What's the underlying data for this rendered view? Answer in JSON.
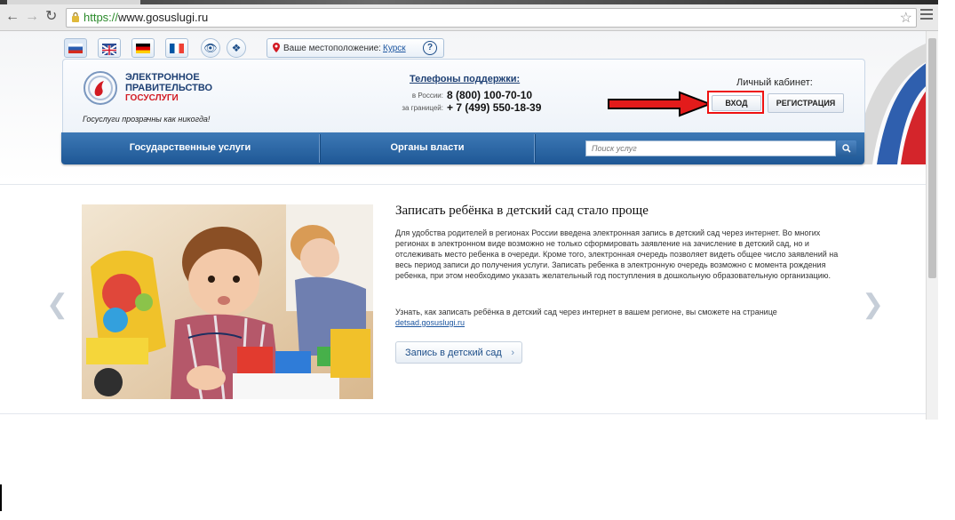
{
  "browser": {
    "url_prefix": "https://",
    "url_host": "www.gosuslugi.ru"
  },
  "colors": {
    "brand_blue": "#1d3f73",
    "nav_blue": "#2a63a3",
    "brand_red": "#d21a22",
    "highlight_red": "#e11111"
  },
  "location": {
    "label": "Ваше местоположение:",
    "city": "Курск",
    "help": "?"
  },
  "logo": {
    "line1": "ЭЛЕКТРОННОЕ",
    "line2": "ПРАВИТЕЛЬСТВО",
    "line3": "ГОСУСЛУГИ",
    "slogan": "Госуслуги прозрачны как никогда!"
  },
  "support": {
    "title": "Телефоны поддержки:",
    "russia_label": "в России:",
    "russia_phone": "8 (800) 100-70-10",
    "abroad_label": "за границей:",
    "abroad_phone": "+ 7 (499) 550-18-39"
  },
  "account": {
    "label": "Личный кабинет:",
    "login": "ВХОД",
    "register": "РЕГИСТРАЦИЯ"
  },
  "nav": {
    "services": "Государственные услуги",
    "authorities": "Органы власти",
    "search_placeholder": "Поиск услуг"
  },
  "article": {
    "title": "Записать ребёнка в детский сад стало проще",
    "body": "Для удобства родителей в регионах России введена электронная запись в детский сад через интернет. Во многих регионах в электронном виде возможно не только сформировать заявление на зачисление в детский сад, но и отслеживать место ребенка в очереди. Кроме того, электронная очередь позволяет видеть общее число заявлений на весь период записи до получения услуги. Записать ребенка в электронную очередь возможно с момента рождения ребенка, при этом необходимо указать желательный год поступления в дошкольную образовательную организацию.",
    "more": "Узнать, как записать ребёнка в детский сад через интернет в вашем регионе, вы сможете на странице",
    "link": "detsad.gosuslugi.ru",
    "button": "Запись в детский сад"
  }
}
